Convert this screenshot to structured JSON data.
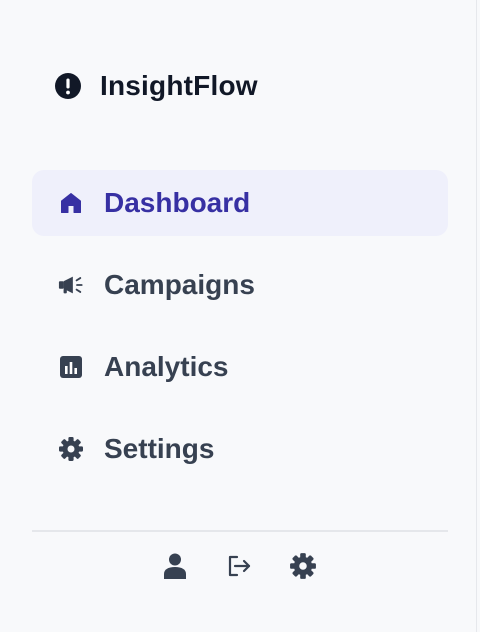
{
  "app": {
    "name": "InsightFlow",
    "logo_icon": "alert-circle-icon"
  },
  "colors": {
    "active_bg": "#eff0fb",
    "active_text": "#3730a3",
    "text": "#374151",
    "brand_text": "#111827"
  },
  "nav": {
    "items": [
      {
        "label": "Dashboard",
        "icon": "home-icon",
        "active": true
      },
      {
        "label": "Campaigns",
        "icon": "megaphone-icon",
        "active": false
      },
      {
        "label": "Analytics",
        "icon": "chart-bar-icon",
        "active": false
      },
      {
        "label": "Settings",
        "icon": "gear-icon",
        "active": false
      }
    ]
  },
  "footer": {
    "buttons": [
      {
        "icon": "user-icon"
      },
      {
        "icon": "logout-icon"
      },
      {
        "icon": "gear-icon"
      }
    ]
  }
}
